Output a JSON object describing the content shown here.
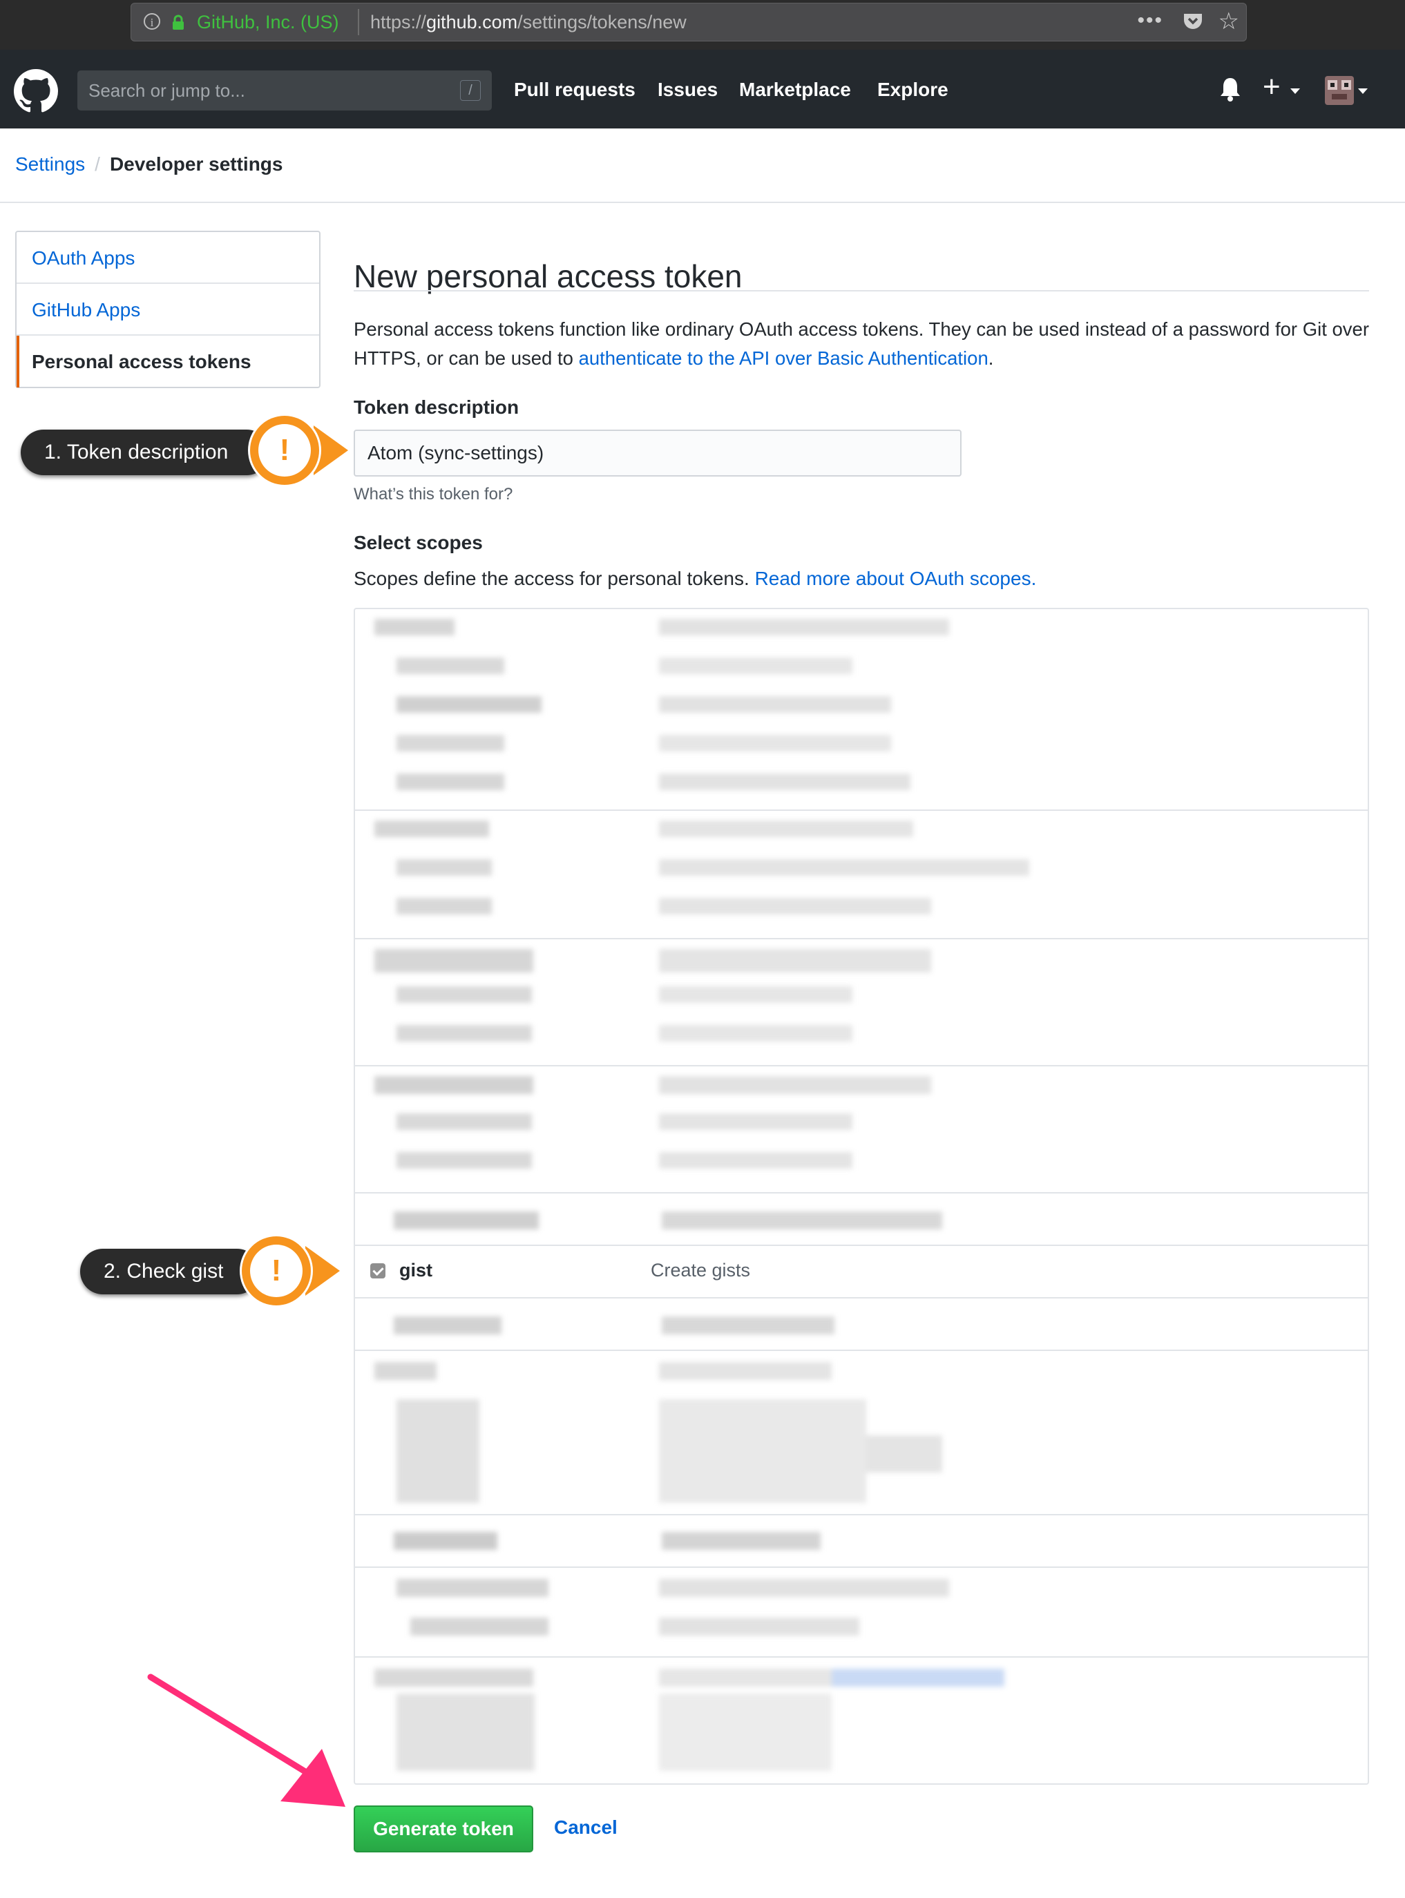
{
  "browser": {
    "site_identity": "GitHub, Inc. (US)",
    "url_prefix": "https://",
    "url_domain": "github.com",
    "url_path": "/settings/tokens/new",
    "menu_dots": "•••"
  },
  "header": {
    "search_placeholder": "Search or jump to...",
    "search_shortcut": "/",
    "nav": [
      "Pull requests",
      "Issues",
      "Marketplace",
      "Explore"
    ],
    "plus": "+"
  },
  "breadcrumb": {
    "root": "Settings",
    "separator": "/",
    "current": "Developer settings"
  },
  "sidebar": {
    "items": [
      {
        "label": "OAuth Apps",
        "selected": false
      },
      {
        "label": "GitHub Apps",
        "selected": false
      },
      {
        "label": "Personal access tokens",
        "selected": true
      }
    ]
  },
  "main": {
    "title": "New personal access token",
    "intro_text": "Personal access tokens function like ordinary OAuth access tokens. They can be used instead of a password for Git over HTTPS, or can be used to ",
    "intro_link": "authenticate to the API over Basic Authentication",
    "intro_end": ".",
    "token_label": "Token description",
    "token_value": "Atom (sync-settings)",
    "token_note": "What’s this token for?",
    "scopes_label": "Select scopes",
    "scopes_text": "Scopes define the access for personal tokens. ",
    "scopes_link": "Read more about OAuth scopes.",
    "gist_scope": {
      "name": "gist",
      "description": "Create gists",
      "checked": true
    },
    "generate_button": "Generate token",
    "cancel_button": "Cancel"
  },
  "annotations": {
    "step1": "1. Token description",
    "step2": "2. Check gist",
    "badge_symbol": "!",
    "badge_color": "#f7941d",
    "arrow_color": "#ff2d78"
  },
  "colors": {
    "link": "#0366d6",
    "header_bg": "#24292e",
    "button_green": "#28a745",
    "selected_accent": "#e36209"
  }
}
